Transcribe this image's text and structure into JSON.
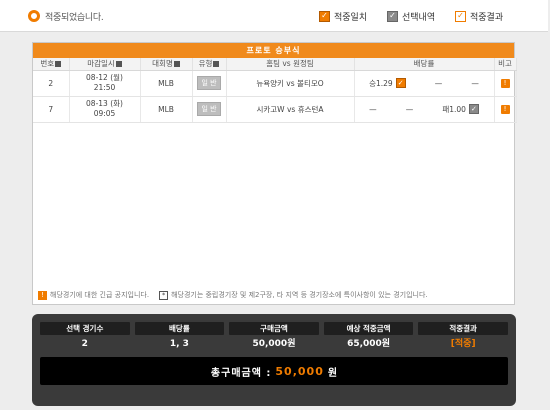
{
  "header": {
    "message": "적중되었습니다.",
    "legend": [
      {
        "label": "적중일치",
        "style": "orange",
        "mark": "✓"
      },
      {
        "label": "선택내역",
        "style": "gray",
        "mark": "✓"
      },
      {
        "label": "적중결과",
        "style": "outline",
        "mark": "✓"
      }
    ]
  },
  "panel": {
    "title": "프로토 승부식",
    "columns": [
      "번호",
      "마감일시",
      "대회명",
      "유형",
      "홈팀 vs 원정팀",
      "배당률",
      "비고"
    ],
    "rows": [
      {
        "no": "2",
        "date": "08-12 (월)",
        "time": "21:50",
        "league": "MLB",
        "type": "일 반",
        "match": "뉴욕양키 vs 볼티모O",
        "odds_win": "승1.29",
        "odds_draw": "—",
        "odds_lose": "—"
      },
      {
        "no": "7",
        "date": "08-13 (화)",
        "time": "09:05",
        "league": "MLB",
        "type": "일 반",
        "match": "시카고W vs 휴스턴A",
        "odds_win": "—",
        "odds_draw": "—",
        "odds_lose": "패1.00"
      }
    ],
    "notice_left": "해당경기에 대한 긴급 공지입니다.",
    "notice_right": "해당경기는 중립경기장 및 제2구장, 타 지역 등 경기장소에 특이사항이 있는 경기입니다."
  },
  "summary": {
    "labels": [
      "선택 경기수",
      "배당률",
      "구매금액",
      "예상 적중금액",
      "적중결과"
    ],
    "values": [
      "2",
      "1, 3",
      "50,000원",
      "65,000원",
      "[적중]"
    ],
    "total_label": "총구매금액 :",
    "total_value": "50,000",
    "total_unit": "원"
  }
}
